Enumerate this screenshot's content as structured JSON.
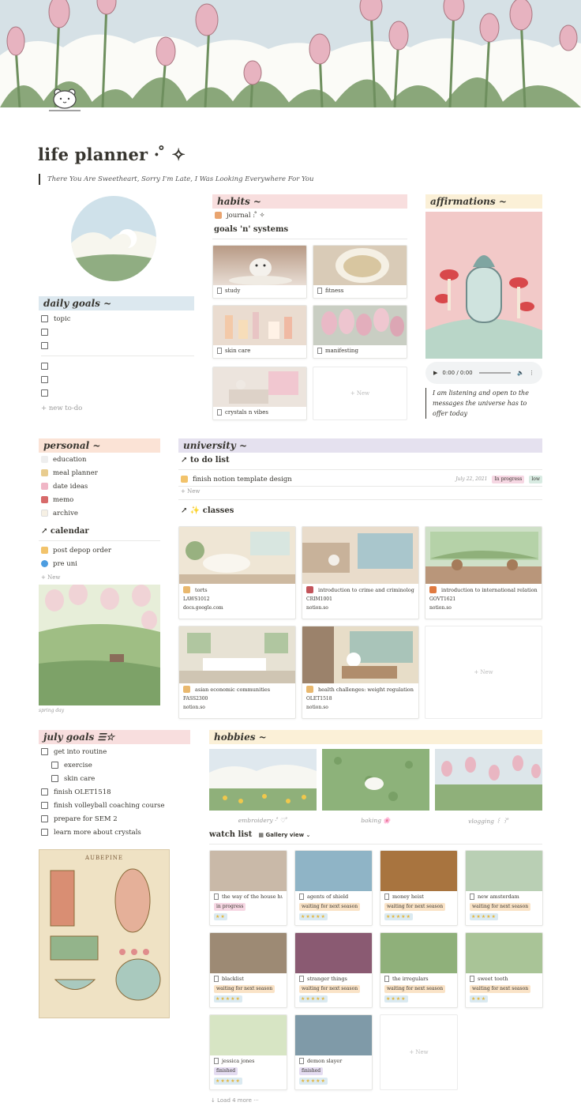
{
  "page": {
    "title": "life planner · ̊ ✧",
    "quote": "There You Are Sweetheart, Sorry I'm Late, I Was Looking Everywhere For You"
  },
  "daily_goals": {
    "header": "daily goals ~",
    "items": [
      "topic",
      "",
      "",
      "",
      "",
      ""
    ],
    "new_label": "+ new to-do"
  },
  "habits": {
    "header": "habits ~",
    "journal": "journal : ̊ ✧",
    "subheading": "goals 'n' systems",
    "cards": [
      "study",
      "fitness",
      "skin care",
      "manifesting",
      "crystals n vibes"
    ],
    "new_label": "+ New"
  },
  "affirmations": {
    "header": "affirmations ~",
    "audio_time": "0:00 / 0:00",
    "text": "I am listening and open to the messages the universe has to offer today"
  },
  "personal": {
    "header": "personal ~",
    "items": [
      "education",
      "meal planner",
      "date ideas",
      "memo",
      "archive"
    ],
    "calendar_title": "calendar",
    "calendar_items": [
      "post depop order",
      "pre uni"
    ],
    "new_label": "+ New",
    "caption": "spring day"
  },
  "university": {
    "header": "university ~",
    "todo_title": "to do list",
    "todo": {
      "task": "finish notion template design",
      "date": "July 22, 2021",
      "status": "In progress",
      "priority": "low"
    },
    "new_label": "+ New",
    "classes_title": "classes",
    "classes": [
      {
        "name": "torts",
        "code": "LAWS1012",
        "url": "docs.google.com"
      },
      {
        "name": "introduction to crime and criminology",
        "code": "CRIM1001",
        "url": "notion.so"
      },
      {
        "name": "introduction to international relations",
        "code": "GOVT1621",
        "url": "notion.so"
      },
      {
        "name": "asian economic communities",
        "code": "FASS2300",
        "url": "notion.so"
      },
      {
        "name": "health challenges: weight regulation",
        "code": "OLET1518",
        "url": "notion.so"
      }
    ],
    "classes_new": "+ New"
  },
  "july_goals": {
    "header": "july goals ☰☆",
    "items": [
      {
        "text": "get into routine",
        "indent": 0
      },
      {
        "text": "exercise",
        "indent": 1
      },
      {
        "text": "skin care",
        "indent": 1
      },
      {
        "text": "finish OLET1518",
        "indent": 0
      },
      {
        "text": "finish volleyball coaching course",
        "indent": 0
      },
      {
        "text": "prepare for SEM 2",
        "indent": 0
      },
      {
        "text": "learn more about crystals",
        "indent": 0
      }
    ]
  },
  "poster": {
    "title": "AUBEPINE"
  },
  "hobbies": {
    "header": "hobbies ~",
    "items": [
      "embroidery · ̊ ♡ ̊",
      "baking 🌸",
      "vlogging ꒰ ꒱ ̊"
    ]
  },
  "watch_list": {
    "title": "watch list",
    "view": "Gallery view",
    "items": [
      {
        "title": "the way of the house hus...",
        "status": "in progress",
        "stars": "★★"
      },
      {
        "title": "agents of shield",
        "status": "waiting for next season",
        "stars": "★★★★★"
      },
      {
        "title": "money heist",
        "status": "waiting for next season",
        "stars": "★★★★★"
      },
      {
        "title": "new amsterdam",
        "status": "waiting for next season",
        "stars": "★★★★★"
      },
      {
        "title": "blacklist",
        "status": "waiting for next season",
        "stars": "★★★★★"
      },
      {
        "title": "stranger things",
        "status": "waiting for next season",
        "stars": "★★★★★"
      },
      {
        "title": "the irregulars",
        "status": "waiting for next season",
        "stars": "★★★★"
      },
      {
        "title": "sweet tooth",
        "status": "waiting for next season",
        "stars": "★★★"
      },
      {
        "title": "jessica jones",
        "status": "finished",
        "stars": "★★★★★"
      },
      {
        "title": "demon slayer",
        "status": "finished",
        "stars": "★★★★★"
      }
    ],
    "new_label": "+ New",
    "load_more": "Load 4 more"
  },
  "colors": {
    "blue": "#dce8ef",
    "pink": "#f8dede",
    "yellow": "#fbf0d7",
    "lavender": "#e5e1ef",
    "peach": "#fbe3d6",
    "tag_progress": "#f6d7e3",
    "tag_waiting": "#fae3c7",
    "tag_finished": "#e4dcf1"
  }
}
